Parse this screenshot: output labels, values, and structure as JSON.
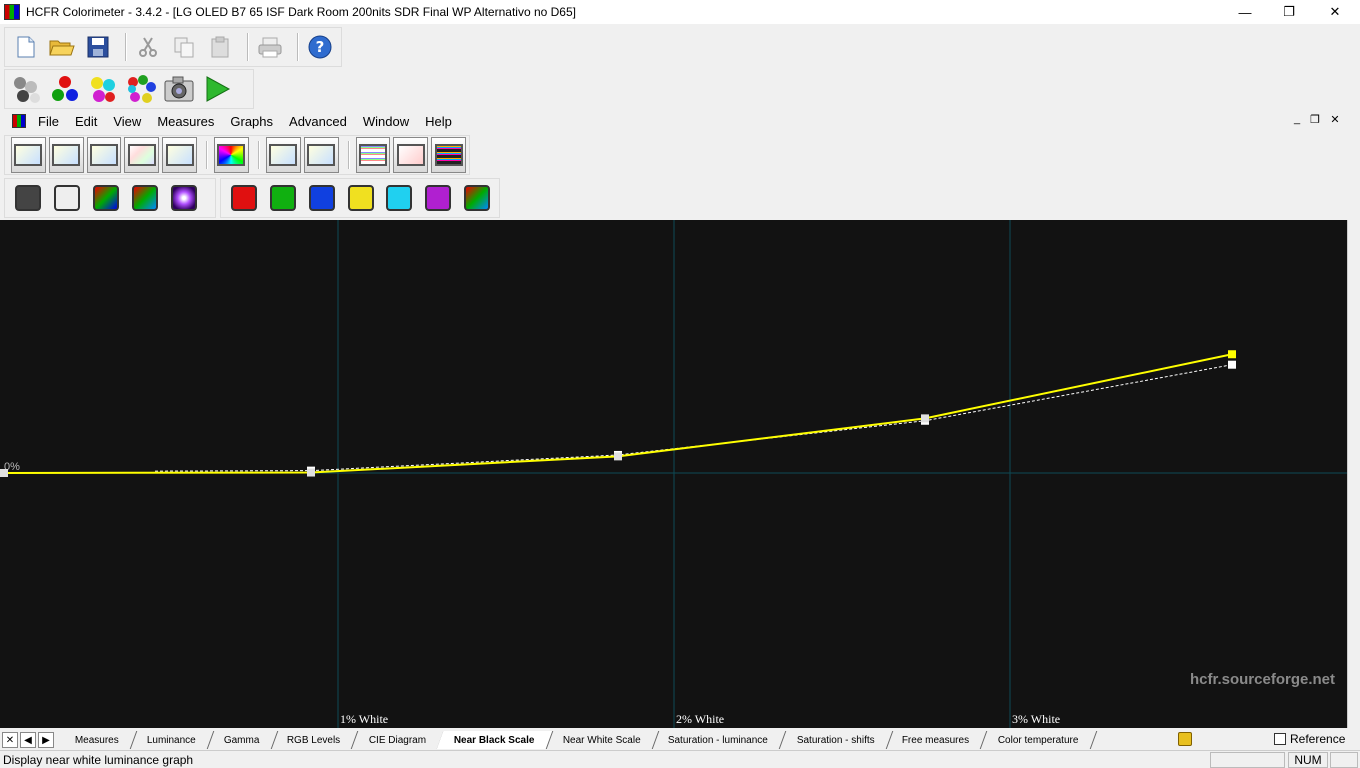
{
  "window": {
    "title": "HCFR Colorimeter - 3.4.2 - [LG OLED B7 65 ISF Dark Room 200nits SDR Final WP Alternativo no D65]",
    "minimize": "—",
    "maximize": "❐",
    "close": "✕"
  },
  "menu": {
    "items": [
      "File",
      "Edit",
      "View",
      "Measures",
      "Graphs",
      "Advanced",
      "Window",
      "Help"
    ],
    "mdi_minimize": "_",
    "mdi_restore": "❐",
    "mdi_close": "✕"
  },
  "graph": {
    "zero_label": "0%",
    "x_labels": [
      "1% White",
      "2% White",
      "3% White"
    ],
    "watermark": "hcfr.sourceforge.net",
    "colors": {
      "background": "#121212",
      "grid": "#0d4a55",
      "measured": "#ffff00",
      "reference": "#ffffff",
      "marker": "#ffffff"
    }
  },
  "chart_data": {
    "type": "line",
    "x": [
      0,
      1,
      2,
      3,
      4
    ],
    "series": [
      {
        "values": [
          0,
          0.1,
          3.5,
          11.5,
          25.0
        ]
      },
      {
        "values": [
          0,
          0.5,
          3.8,
          11.0,
          22.8
        ]
      }
    ]
  },
  "tabs": {
    "items": [
      "Measures",
      "Luminance",
      "Gamma",
      "RGB Levels",
      "CIE Diagram",
      "Near Black Scale",
      "Near White Scale",
      "Saturation - luminance",
      "Saturation - shifts",
      "Free measures",
      "Color temperature"
    ],
    "active": "Near Black Scale",
    "reference_label": "Reference"
  },
  "status": {
    "message": "Display near white luminance graph",
    "num": "NUM"
  }
}
